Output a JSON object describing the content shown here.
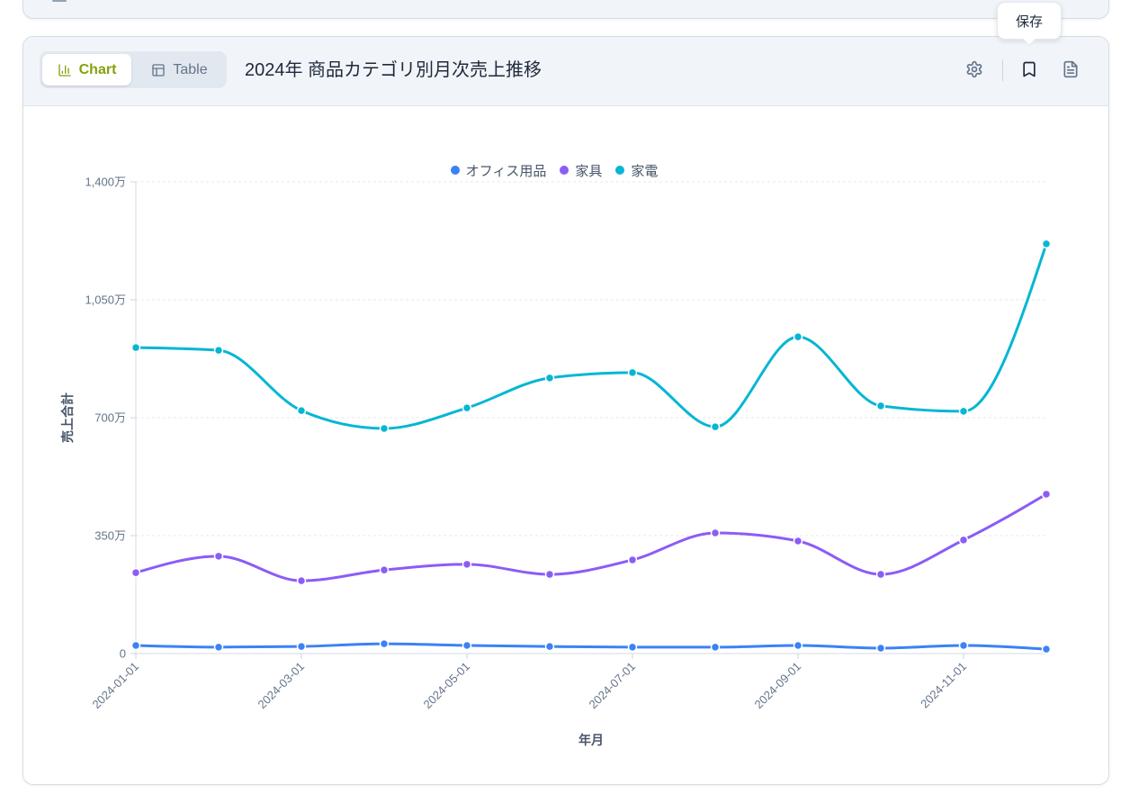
{
  "colors": {
    "accent": "#84a10c",
    "text": "#1e293b",
    "muted": "#64748b",
    "header_bg": "#f1f5f9"
  },
  "header": {
    "view_toggle": [
      {
        "label": "Chart",
        "icon": "bar-chart-icon",
        "active": true
      },
      {
        "label": "Table",
        "icon": "table-icon",
        "active": false
      }
    ],
    "title": "2024年 商品カテゴリ別月次売上推移",
    "actions": [
      "gear-icon",
      "bookmark-icon",
      "document-icon"
    ]
  },
  "tooltip": {
    "label": "保存"
  },
  "chart_data": {
    "type": "line",
    "smooth": true,
    "x": [
      "2024-01-01",
      "2024-02-01",
      "2024-03-01",
      "2024-04-01",
      "2024-05-01",
      "2024-06-01",
      "2024-07-01",
      "2024-08-01",
      "2024-09-01",
      "2024-10-01",
      "2024-11-01",
      "2024-12-01"
    ],
    "x_tick_labels": [
      "2024-01-01",
      "2024-03-01",
      "2024-05-01",
      "2024-07-01",
      "2024-09-01",
      "2024-11-01"
    ],
    "y_ticks": [
      0,
      350,
      700,
      1050,
      1400
    ],
    "y_tick_labels": [
      "0",
      "350万",
      "700万",
      "1,050万",
      "1,400万"
    ],
    "ylim": [
      0,
      1400
    ],
    "xlabel": "年月",
    "ylabel": "売上合計",
    "grid": true,
    "legend": "top",
    "series": [
      {
        "name": "オフィス用品",
        "color": "#3b82f6",
        "values": [
          24,
          19,
          21,
          29,
          24,
          21,
          19,
          19,
          24,
          16,
          24,
          13
        ]
      },
      {
        "name": "家具",
        "color": "#8b5cf6",
        "values": [
          240,
          289,
          216,
          248,
          265,
          235,
          278,
          358,
          334,
          235,
          337,
          473
        ]
      },
      {
        "name": "家電",
        "color": "#06b6d4",
        "values": [
          908,
          900,
          721,
          668,
          729,
          818,
          834,
          673,
          940,
          735,
          719,
          1216
        ]
      }
    ]
  }
}
